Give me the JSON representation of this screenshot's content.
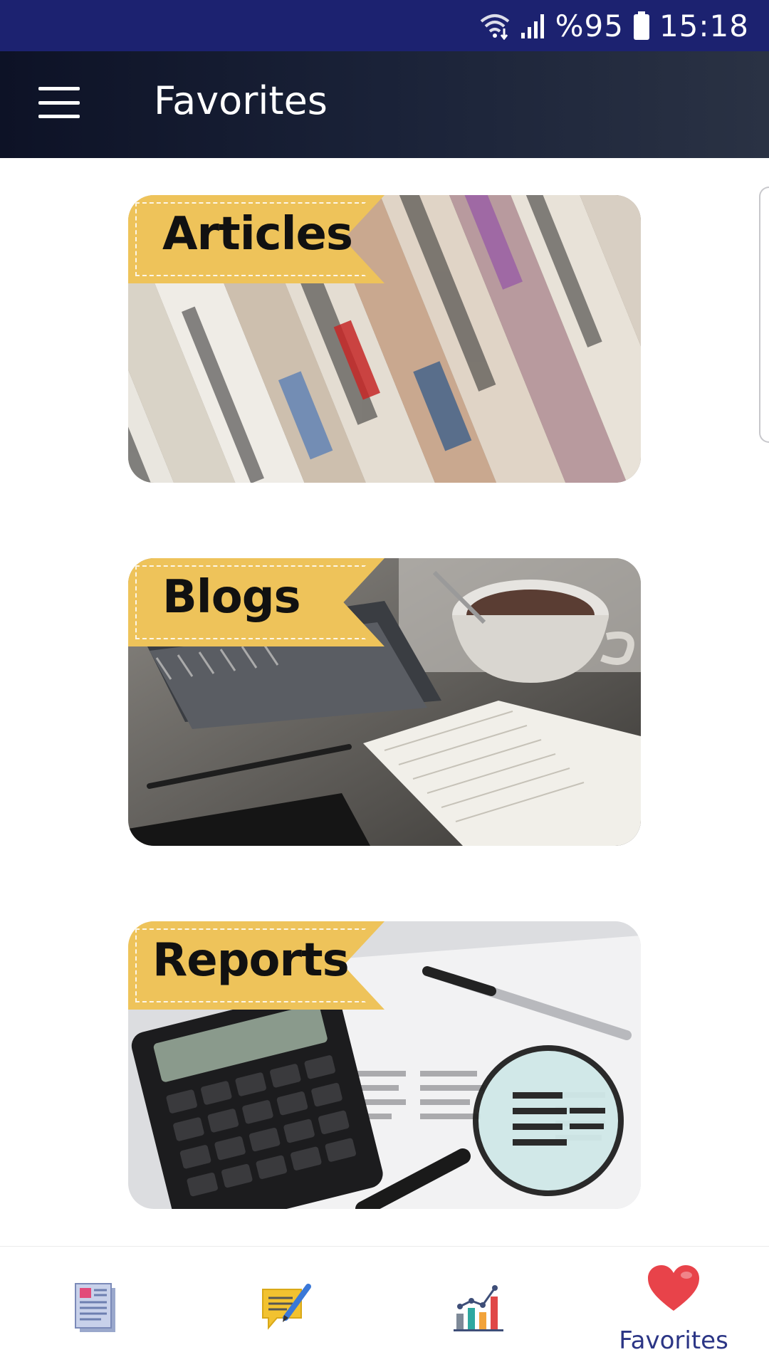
{
  "status_bar": {
    "battery": "%95",
    "time": "15:18",
    "icons": [
      "wifi-icon",
      "signal-icon",
      "battery-icon"
    ]
  },
  "app_bar": {
    "title": "Favorites",
    "menu_icon": "hamburger-menu-icon"
  },
  "cards": [
    {
      "label": "Articles",
      "image": "newspapers"
    },
    {
      "label": "Blogs",
      "image": "notebook-coffee"
    },
    {
      "label": "Reports",
      "image": "calculator-magnifier"
    }
  ],
  "bottom_nav": {
    "items": [
      {
        "icon": "document-icon",
        "label": ""
      },
      {
        "icon": "chat-pen-icon",
        "label": ""
      },
      {
        "icon": "bar-chart-icon",
        "label": ""
      },
      {
        "icon": "heart-icon",
        "label": "Favorites",
        "active": true
      }
    ]
  },
  "colors": {
    "status_bar": "#1c2270",
    "app_bar": "#151b2e",
    "ribbon": "#eec35a",
    "active_label": "#2b3585",
    "heart": "#e8434a"
  }
}
